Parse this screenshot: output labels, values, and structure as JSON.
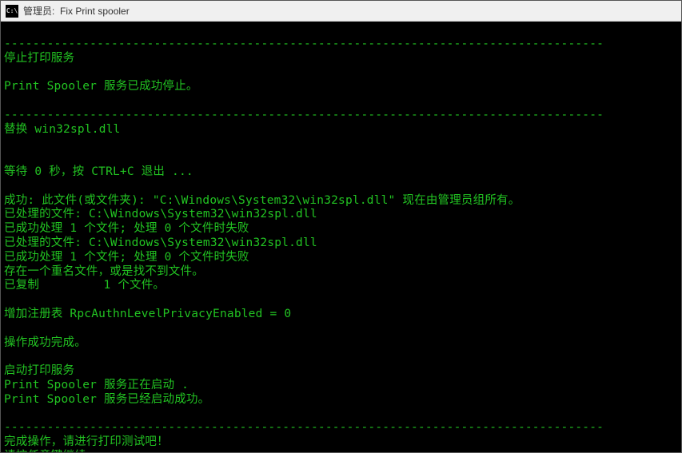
{
  "titlebar": {
    "icon_label": "C:\\",
    "title": "管理员:  Fix Print spooler"
  },
  "lines": [
    "                                                                                                                        ",
    "------------------------------------------------------------------------------------",
    "停止打印服务",
    "",
    "Print Spooler 服务已成功停止。",
    "",
    "------------------------------------------------------------------------------------",
    "替换 win32spl.dll",
    "",
    "",
    "等待 0 秒，按 CTRL+C 退出 ...",
    "",
    "成功: 此文件(或文件夹): \"C:\\Windows\\System32\\win32spl.dll\" 现在由管理员组所有。",
    "已处理的文件: C:\\Windows\\System32\\win32spl.dll",
    "已成功处理 1 个文件; 处理 0 个文件时失败",
    "已处理的文件: C:\\Windows\\System32\\win32spl.dll",
    "已成功处理 1 个文件; 处理 0 个文件时失败",
    "存在一个重名文件，或是找不到文件。",
    "已复制         1 个文件。",
    "",
    "增加注册表 RpcAuthnLevelPrivacyEnabled = 0",
    "",
    "操作成功完成。",
    "",
    "启动打印服务",
    "Print Spooler 服务正在启动 .",
    "Print Spooler 服务已经启动成功。",
    "",
    "------------------------------------------------------------------------------------",
    "完成操作，请进行打印测试吧！",
    "请按任意键继续. . ."
  ]
}
